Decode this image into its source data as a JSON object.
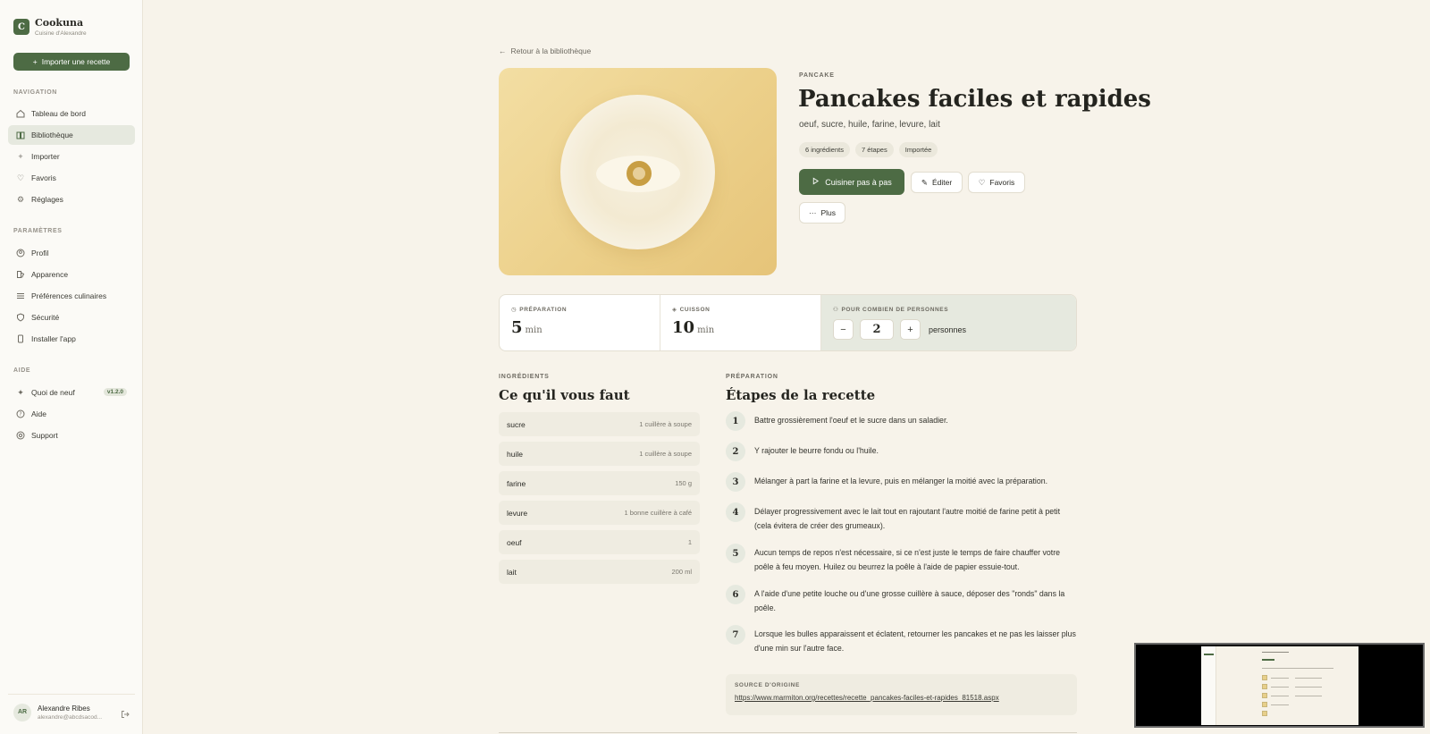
{
  "app": {
    "name": "Cookuna",
    "subtitle": "Cuisine d'Alexandre",
    "logo_letter": "C",
    "accent_color": "#4d6b44"
  },
  "sidebar": {
    "import_button": "Importer une recette",
    "navigation_title": "NAVIGATION",
    "navigation": [
      {
        "label": "Tableau de bord",
        "icon": "home-icon"
      },
      {
        "label": "Bibliothèque",
        "icon": "book-icon",
        "active": true
      },
      {
        "label": "Importer",
        "icon": "plus-icon"
      },
      {
        "label": "Favoris",
        "icon": "heart-icon"
      },
      {
        "label": "Réglages",
        "icon": "gear-icon"
      }
    ],
    "settings_title": "PARAMÈTRES",
    "settings": [
      {
        "label": "Profil",
        "icon": "user-circle-icon"
      },
      {
        "label": "Apparence",
        "icon": "palette-icon"
      },
      {
        "label": "Préférences culinaires",
        "icon": "sliders-icon"
      },
      {
        "label": "Sécurité",
        "icon": "shield-icon"
      },
      {
        "label": "Installer l'app",
        "icon": "phone-icon"
      }
    ],
    "help_title": "AIDE",
    "help": [
      {
        "label": "Quoi de neuf",
        "icon": "sparkles-icon",
        "badge": "v1.2.0"
      },
      {
        "label": "Aide",
        "icon": "help-circle-icon"
      },
      {
        "label": "Support",
        "icon": "lifebuoy-icon"
      }
    ],
    "user": {
      "initials": "AR",
      "name": "Alexandre Ribes",
      "email": "alexandre@abcdsacod..."
    }
  },
  "recipe": {
    "back_link": "Retour à la bibliothèque",
    "category": "PANCAKE",
    "title": "Pancakes faciles et rapides",
    "summary": "oeuf, sucre, huile, farine, levure, lait",
    "chips": [
      "6 ingrédients",
      "7 étapes",
      "Importée"
    ],
    "actions": {
      "cook": "Cuisiner pas à pas",
      "edit": "Éditer",
      "favorite": "Favoris",
      "more": "Plus"
    },
    "stats": {
      "prep_label": "PRÉPARATION",
      "prep_value": "5",
      "prep_unit": "min",
      "cook_label": "CUISSON",
      "cook_value": "10",
      "cook_unit": "min",
      "servings_label": "POUR COMBIEN DE PERSONNES",
      "servings_value": "2",
      "servings_unit": "personnes",
      "minus": "−",
      "plus": "+"
    },
    "ingredients_label": "INGRÉDIENTS",
    "ingredients_title": "Ce qu'il vous faut",
    "ingredients": [
      {
        "name": "sucre",
        "qty": "1 cuillère à soupe"
      },
      {
        "name": "huile",
        "qty": "1 cuillère à soupe"
      },
      {
        "name": "farine",
        "qty": "150 g"
      },
      {
        "name": "levure",
        "qty": "1 bonne cuillère à café"
      },
      {
        "name": "oeuf",
        "qty": "1"
      },
      {
        "name": "lait",
        "qty": "200 ml"
      }
    ],
    "steps_label": "PRÉPARATION",
    "steps_title": "Étapes de la recette",
    "steps": [
      {
        "n": "1",
        "text": "Battre grossièrement l'oeuf et le sucre dans un saladier."
      },
      {
        "n": "2",
        "text": "Y rajouter le beurre fondu ou l'huile."
      },
      {
        "n": "3",
        "text": "Mélanger à part la farine et la levure, puis en mélanger la moitié avec la préparation."
      },
      {
        "n": "4",
        "text": "Délayer progressivement avec le lait tout en rajoutant l'autre moitié de farine petit à petit (cela évitera de créer des grumeaux)."
      },
      {
        "n": "5",
        "text": "Aucun temps de repos n'est nécessaire, si ce n'est juste le temps de faire chauffer votre poêle à feu moyen. Huilez ou beurrez la poêle à l'aide de papier essuie-tout."
      },
      {
        "n": "6",
        "text": "A l'aide d'une petite louche ou d'une grosse cuillère à sauce, déposer des \"ronds\" dans la poêle."
      },
      {
        "n": "7",
        "text": "Lorsque les bulles apparaissent et éclatent, retourner les pancakes et ne pas les laisser plus d'une min sur l'autre face."
      }
    ],
    "source_label": "SOURCE D'ORIGINE",
    "source_url": "https://www.marmiton.org/recettes/recette_pancakes-faciles-et-rapides_81518.aspx"
  }
}
